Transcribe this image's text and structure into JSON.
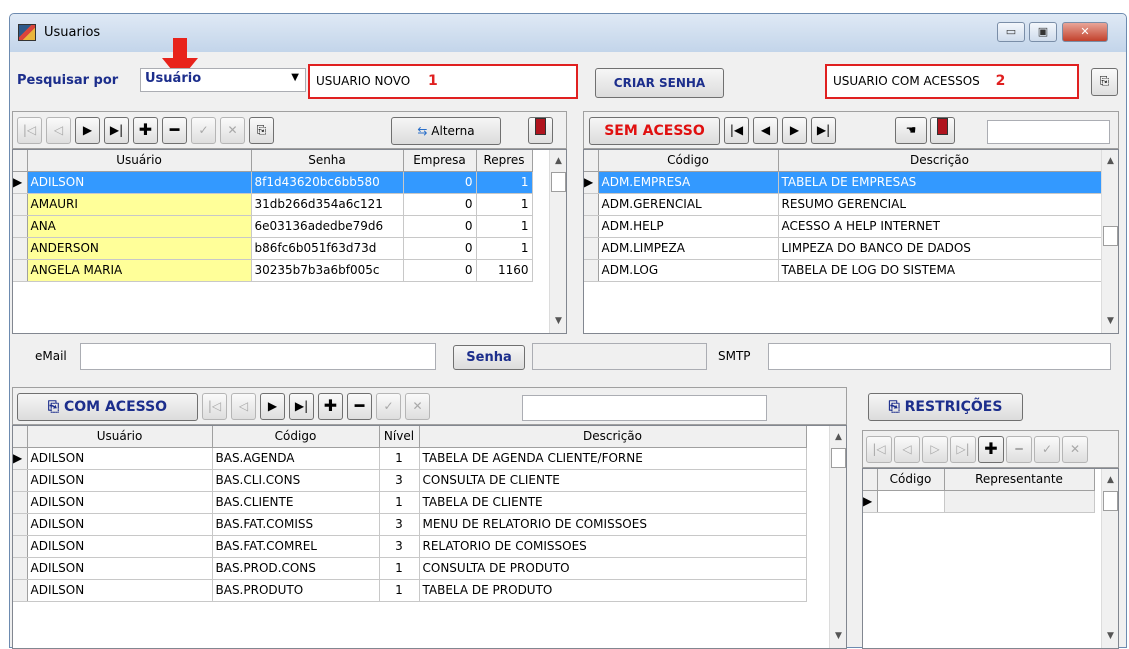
{
  "window": {
    "title": "Usuarios",
    "buttons": {
      "minimize": "▭",
      "maximize": "▣",
      "close": "✕"
    }
  },
  "search": {
    "label": "Pesquisar por",
    "by_value": "Usuário",
    "new_user_value": "USUARIO NOVO",
    "marker1": "1",
    "create_password_label": "CRIAR SENHA",
    "access_user_value": "USUARIO COM ACESSOS",
    "marker2": "2"
  },
  "users_toolbar": {
    "alterna_label": "Alterna"
  },
  "users_grid": {
    "columns": [
      "Usuário",
      "Senha",
      "Empresa",
      "Repres"
    ],
    "rows": [
      {
        "usuario": "ADILSON",
        "senha": "8f1d43620bc6bb580",
        "empresa": "0",
        "repres": "1"
      },
      {
        "usuario": "AMAURI",
        "senha": "31db266d354a6c121",
        "empresa": "0",
        "repres": "1"
      },
      {
        "usuario": "ANA",
        "senha": "6e03136adedbe79d6",
        "empresa": "0",
        "repres": "1"
      },
      {
        "usuario": "ANDERSON",
        "senha": "b86fc6b051f63d73d",
        "empresa": "0",
        "repres": "1"
      },
      {
        "usuario": "ANGELA MARIA",
        "senha": "30235b7b3a6bf005c",
        "empresa": "0",
        "repres": "1160"
      }
    ]
  },
  "no_access": {
    "button_label": "SEM ACESSO",
    "columns": [
      "Código",
      "Descrição"
    ],
    "rows": [
      {
        "codigo": "ADM.EMPRESA",
        "descricao": "TABELA DE EMPRESAS"
      },
      {
        "codigo": "ADM.GERENCIAL",
        "descricao": "RESUMO GERENCIAL"
      },
      {
        "codigo": "ADM.HELP",
        "descricao": "ACESSO A HELP INTERNET"
      },
      {
        "codigo": "ADM.LIMPEZA",
        "descricao": "LIMPEZA DO BANCO DE DADOS"
      },
      {
        "codigo": "ADM.LOG",
        "descricao": "TABELA DE LOG DO SISTEMA"
      }
    ]
  },
  "email_row": {
    "email_label": "eMail",
    "senha_label": "Senha",
    "smtp_label": "SMTP"
  },
  "with_access": {
    "button_label": "COM ACESSO",
    "columns": [
      "Usuário",
      "Código",
      "Nível",
      "Descrição"
    ],
    "rows": [
      {
        "usuario": "ADILSON",
        "codigo": "BAS.AGENDA",
        "nivel": "1",
        "descricao": "TABELA DE AGENDA CLIENTE/FORNE"
      },
      {
        "usuario": "ADILSON",
        "codigo": "BAS.CLI.CONS",
        "nivel": "3",
        "descricao": "CONSULTA DE CLIENTE"
      },
      {
        "usuario": "ADILSON",
        "codigo": "BAS.CLIENTE",
        "nivel": "1",
        "descricao": "TABELA DE CLIENTE"
      },
      {
        "usuario": "ADILSON",
        "codigo": "BAS.FAT.COMISS",
        "nivel": "3",
        "descricao": "MENU DE RELATORIO DE COMISSOES"
      },
      {
        "usuario": "ADILSON",
        "codigo": "BAS.FAT.COMREL",
        "nivel": "3",
        "descricao": "RELATORIO DE COMISSOES"
      },
      {
        "usuario": "ADILSON",
        "codigo": "BAS.PROD.CONS",
        "nivel": "1",
        "descricao": "CONSULTA DE PRODUTO"
      },
      {
        "usuario": "ADILSON",
        "codigo": "BAS.PRODUTO",
        "nivel": "1",
        "descricao": "TABELA DE PRODUTO"
      }
    ]
  },
  "restrictions": {
    "button_label": "RESTRIÇÕES",
    "columns": [
      "Código",
      "Representante"
    ]
  },
  "colors": {
    "accent_red": "#e02020",
    "selection_blue": "#3399ff",
    "highlight_yellow": "#ffff99",
    "label_blue": "#1c2e8c"
  }
}
